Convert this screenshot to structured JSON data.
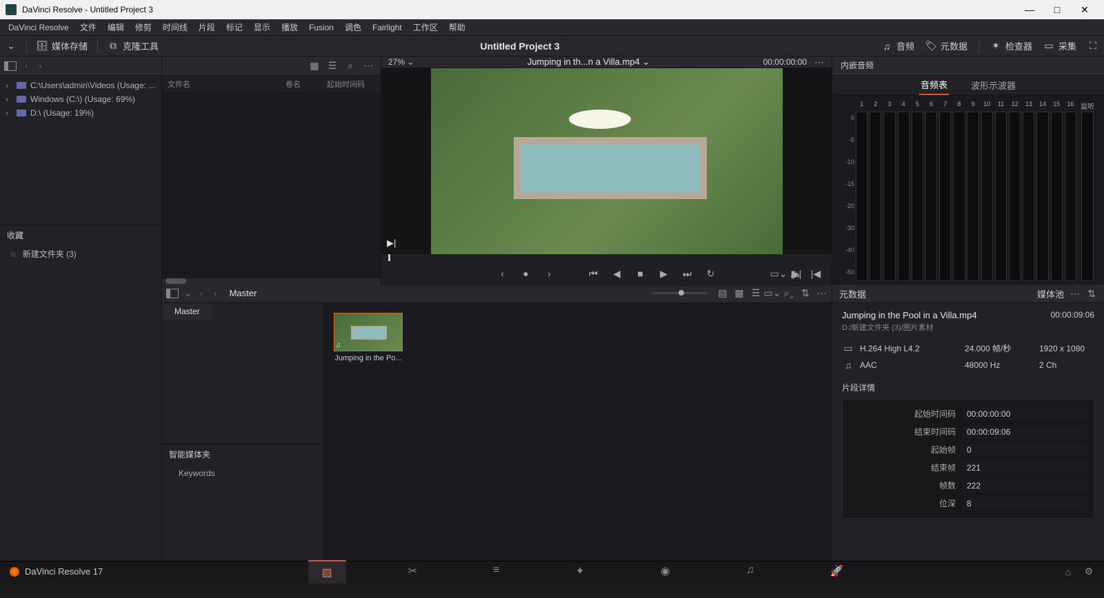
{
  "window": {
    "title": "DaVinci Resolve - Untitled Project 3"
  },
  "menu": [
    "DaVinci Resolve",
    "文件",
    "编辑",
    "修剪",
    "时间线",
    "片段",
    "标记",
    "显示",
    "播放",
    "Fusion",
    "调色",
    "Fairlight",
    "工作区",
    "帮助"
  ],
  "toolbar": {
    "media_storage": "媒体存储",
    "clone_tool": "克隆工具",
    "project_title": "Untitled Project 3",
    "audio": "音频",
    "metadata": "元数据",
    "inspector": "检查器",
    "capture": "采集"
  },
  "drives": [
    "C:\\Users\\admin\\Videos (Usage: ...",
    "Windows (C:\\) (Usage: 69%)",
    "D:\\ (Usage: 19%)"
  ],
  "file_cols": {
    "name": "文件名",
    "reel": "卷名",
    "start": "起始时间码"
  },
  "favorites": {
    "header": "收藏",
    "items": [
      "新建文件夹 (3)"
    ]
  },
  "viewer": {
    "zoom": "27%",
    "title": "Jumping in th...n a Villa.mp4",
    "timecode": "00:00:00:00"
  },
  "pool": {
    "breadcrumb": "Master",
    "bin": "Master",
    "smart_header": "智能媒体夹",
    "keywords": "Keywords",
    "clip_label": "Jumping in the Po..."
  },
  "audio_panel": {
    "header": "内嵌音频",
    "tab_meters": "音频表",
    "tab_wave": "波形示波器",
    "db_labels": [
      "0",
      "-5",
      "-10",
      "-15",
      "-20",
      "-30",
      "-40",
      "-50"
    ],
    "tracks": [
      "1",
      "2",
      "3",
      "4",
      "5",
      "6",
      "7",
      "8",
      "9",
      "10",
      "11",
      "12",
      "13",
      "14",
      "15",
      "16"
    ],
    "listen": "监听"
  },
  "metadata": {
    "header": "元数据",
    "pool_label": "媒体池",
    "clip_name": "Jumping in the Pool in a Villa.mp4",
    "clip_path": "D:/新建文件夹 (3)/图片素材",
    "duration": "00:00:09:06",
    "video_codec": "H.264 High L4.2",
    "fps": "24.000 帧/秒",
    "resolution": "1920 x 1080",
    "audio_codec": "AAC",
    "sample_rate": "48000 Hz",
    "channels": "2 Ch",
    "detail_header": "片段详情",
    "rows": [
      {
        "lbl": "起始时间码",
        "val": "00:00:00:00"
      },
      {
        "lbl": "结束时间码",
        "val": "00:00:09:06"
      },
      {
        "lbl": "起始帧",
        "val": "0"
      },
      {
        "lbl": "结束帧",
        "val": "221"
      },
      {
        "lbl": "帧数",
        "val": "222"
      },
      {
        "lbl": "位深",
        "val": "8"
      }
    ]
  },
  "bottom": {
    "brand": "DaVinci Resolve 17"
  }
}
